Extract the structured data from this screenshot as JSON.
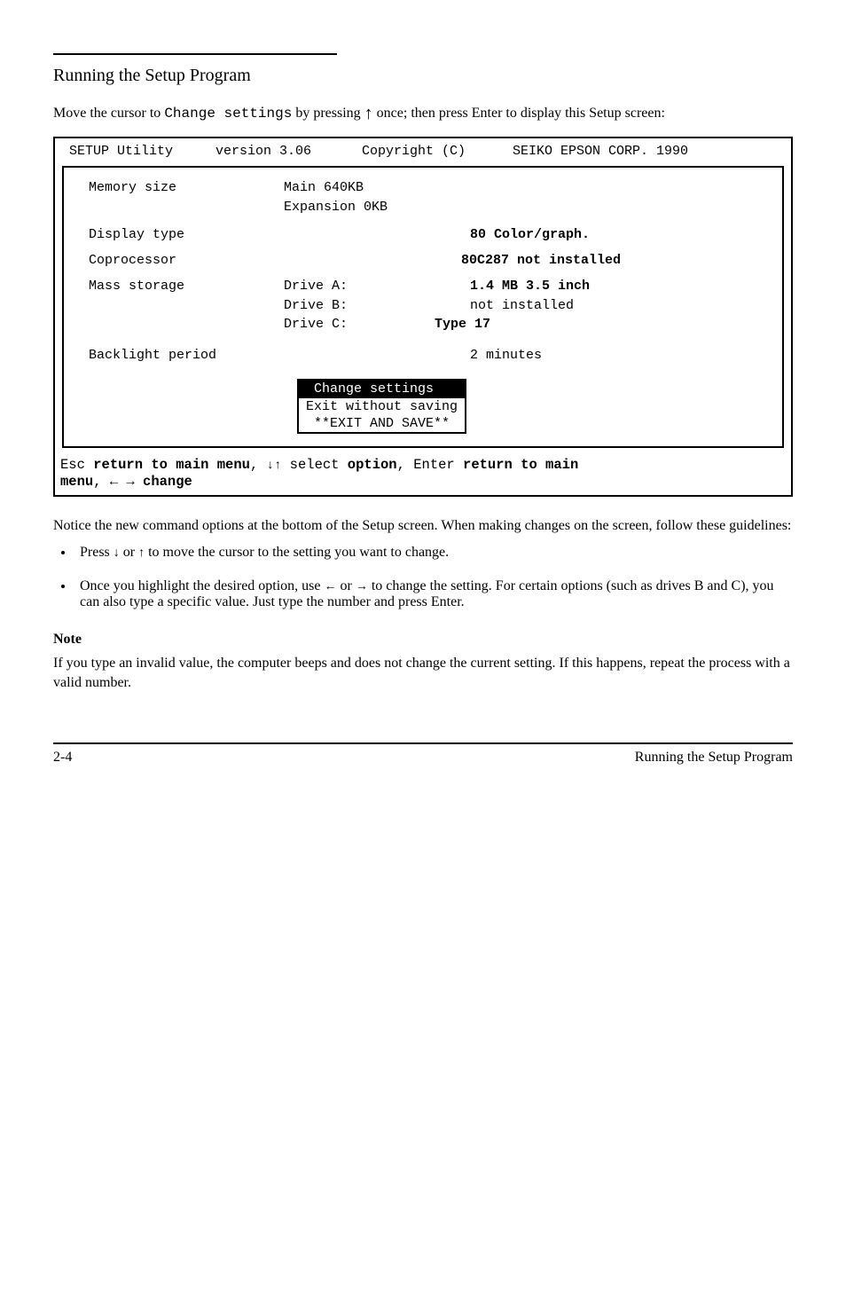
{
  "chapter": "Running the Setup Program",
  "intro": {
    "pre": "Move the cursor to ",
    "opt": "Change settings",
    "mid": " by pressing ",
    "post": " once; then press Enter to display this Setup screen:"
  },
  "screen": {
    "header": {
      "h1": "SETUP Utility",
      "h2": "version 3.06",
      "h3": "Copyright (C)",
      "h4": "SEIKO EPSON CORP. 1990"
    },
    "rows": {
      "memory_label": "Memory size",
      "memory_main": "Main 640KB",
      "memory_exp": "Expansion 0KB",
      "display_label": "Display type",
      "display_value": "80 Color/graph.",
      "coproc_label": "Coprocessor",
      "coproc_value": "80C287 not installed",
      "mass_label": "Mass storage",
      "mass_a": "Drive A: 1.4 MB 3.5 inch",
      "mass_b": "Drive B: not installed",
      "mass_c": "Drive C:",
      "mass_c_type": "Type 17",
      "backlight_label": "Backlight period",
      "backlight_value": "2 minutes"
    },
    "menu": {
      "m1": " Change settings ",
      "m2": "Exit without saving",
      "m3": " **EXIT AND SAVE** "
    },
    "hints": {
      "line1a": "Esc ",
      "line1b": "return to main menu",
      "line1c": ", ",
      "line1d": " select ",
      "line1e": "option",
      "line1f": ", Enter ",
      "line1g": "return to main",
      "line2a": "menu",
      "line2b": ", ← → ",
      "line2c": "change"
    }
  },
  "para_after": "Notice the new command options at the bottom of the Setup screen. When making changes on the screen, follow these guidelines:",
  "bullets": {
    "b1": {
      "p1": "Press ",
      "p2": " or ",
      "p3": " to move the cursor to the setting you want to change."
    },
    "b2": {
      "p1": "Once you highlight the desired option, use ",
      "p2": " or ",
      "p3": " to change the setting. For certain options (such as drives B and C), you can also type a specific value. Just type the number and press Enter."
    }
  },
  "note": {
    "hd": "Note",
    "text": "If you type an invalid value, the computer beeps and does not change the current setting. If this happens, repeat the process with a valid number."
  },
  "footer": {
    "left": "2-4",
    "right": "Running the Setup Program"
  }
}
